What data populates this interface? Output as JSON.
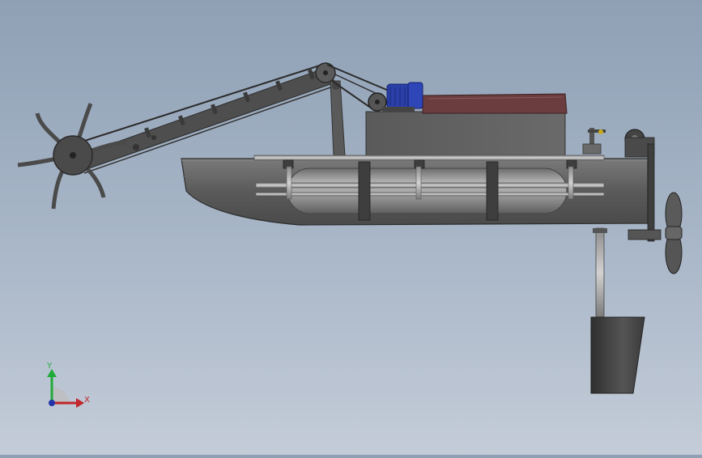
{
  "viewport": {
    "background_top": "#8fa0b5",
    "background_bottom": "#c4ccd8"
  },
  "axis_triad": {
    "y_label": "Y",
    "x_label": "X",
    "y_color": "#1faa3a",
    "x_color": "#c0262b",
    "z_color": "#2233aa"
  },
  "colors": {
    "hull": "#5a5a5a",
    "hull_light": "#8a8a8a",
    "deck_box": "#5f5f5f",
    "panel_top": "#6b3d3f",
    "motor": "#2a3fa8",
    "cutter": "#4a4a4a",
    "rudder": "#3f3f3f"
  },
  "icons": [
    "axis-triad-icon"
  ]
}
